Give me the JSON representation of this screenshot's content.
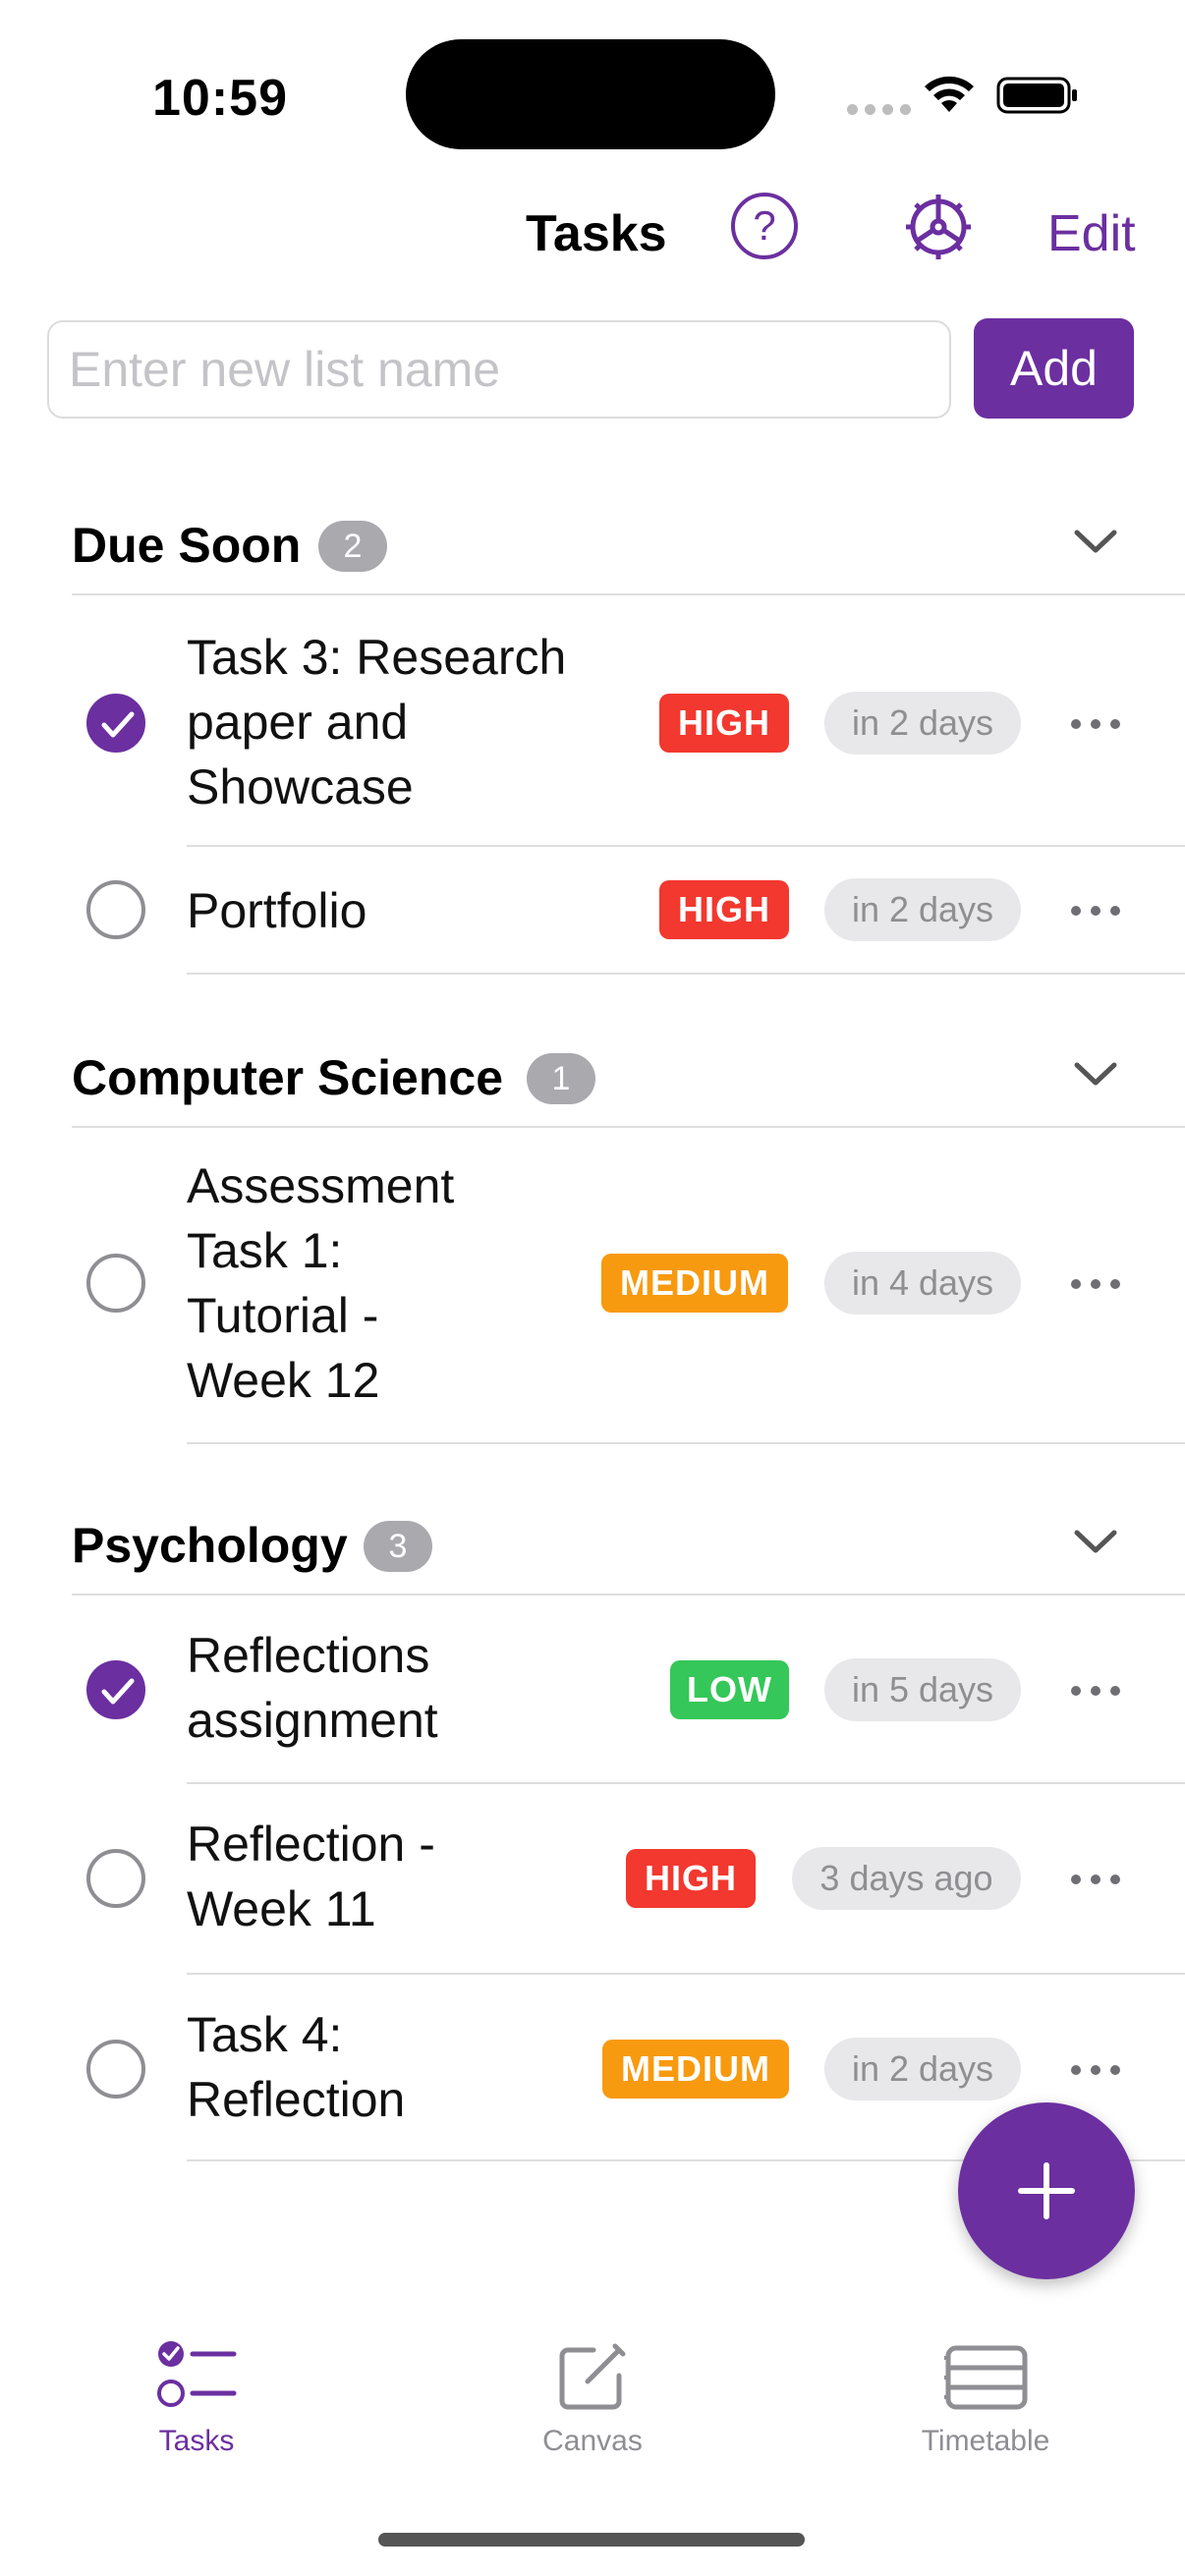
{
  "status_bar": {
    "time": "10:59"
  },
  "nav": {
    "title": "Tasks",
    "help_icon": "question-circle-icon",
    "settings_icon": "gear-icon",
    "edit_label": "Edit"
  },
  "new_list": {
    "placeholder": "Enter new list name",
    "add_label": "Add"
  },
  "colors": {
    "accent": "#6b2fa0",
    "high": "#f2382f",
    "medium": "#f79a0f",
    "low": "#35c759"
  },
  "sections": [
    {
      "title": "Due Soon",
      "count": "2",
      "tasks": [
        {
          "title": "Task 3: Research paper and Showcase",
          "done": true,
          "priority": "HIGH",
          "due": "in 2 days"
        },
        {
          "title": "Portfolio",
          "done": false,
          "priority": "HIGH",
          "due": "in 2 days"
        }
      ]
    },
    {
      "title": "Computer Science",
      "count": "1",
      "tasks": [
        {
          "title": "Assessment Task 1: Tutorial - Week 12",
          "done": false,
          "priority": "MEDIUM",
          "due": "in 4 days"
        }
      ]
    },
    {
      "title": "Psychology",
      "count": "3",
      "tasks": [
        {
          "title": "Reflections assignment",
          "done": true,
          "priority": "LOW",
          "due": "in 5 days"
        },
        {
          "title": "Reflection - Week 11",
          "done": false,
          "priority": "HIGH",
          "due": "3 days ago"
        },
        {
          "title": "Task 4: Reflection",
          "done": false,
          "priority": "MEDIUM",
          "due": "in 2 days"
        }
      ]
    }
  ],
  "fab": {
    "icon": "plus-icon"
  },
  "tab_bar": {
    "tabs": [
      {
        "label": "Tasks",
        "icon": "task-list-icon",
        "active": true
      },
      {
        "label": "Canvas",
        "icon": "compose-icon",
        "active": false
      },
      {
        "label": "Timetable",
        "icon": "timetable-icon",
        "active": false
      }
    ]
  }
}
